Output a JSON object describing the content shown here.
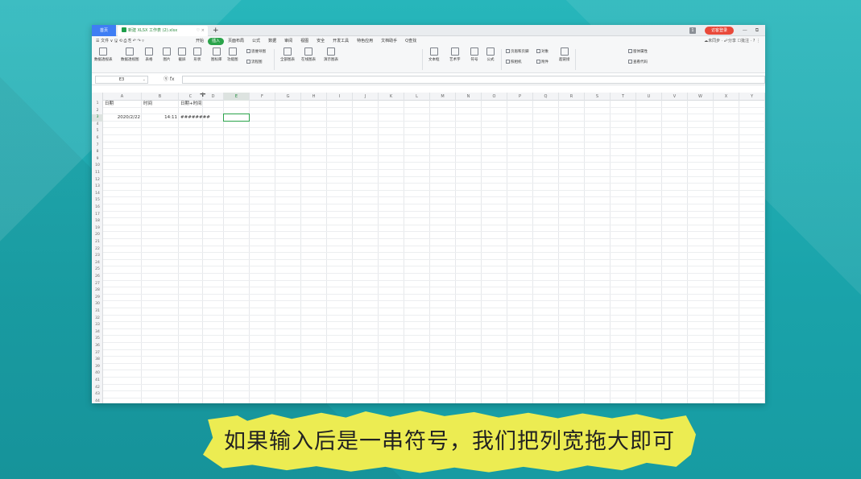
{
  "titlebar": {
    "home_tab": "首页",
    "doc_tab": "新建 XLSX 工作表 (2).xlsx",
    "doc_tab_actions": "♡ ×",
    "add_tab": "+",
    "badge": "1",
    "login_button": "访客登录",
    "window_controls": "— ⧉"
  },
  "menubar": {
    "left_text": "☰ 文件 ∨  🖫 ⟲ ⎙ ⎘ ↶ ↷ ▿",
    "items": [
      "开始",
      "插入",
      "页面布局",
      "公式",
      "数据",
      "审阅",
      "视图",
      "安全",
      "开发工具",
      "特色应用",
      "文档助手",
      "Q查找"
    ],
    "active_item": "插入",
    "right_text": "☁未同步 · ☍分享 ☐批注 · ? ⋮"
  },
  "ribbon": {
    "large_buttons": [
      "数据透视表",
      "数据透视图",
      "表格",
      "图片",
      "截屏",
      "形状",
      "图标库",
      "功能图",
      "全部图表",
      "在线图表",
      "演示图表",
      "文本框",
      "艺术字",
      "符号",
      "公式",
      "超链接"
    ],
    "small_row1": [
      "思维导图",
      "页眉和页脚",
      "对象",
      "窗体属性"
    ],
    "small_row2": [
      "流程图",
      "照相机",
      "附件",
      "查看代码"
    ]
  },
  "formulabar": {
    "name_box": "E3",
    "fx_label": "ⓠ fx",
    "formula": ""
  },
  "grid": {
    "columns": [
      "A",
      "B",
      "C",
      "D",
      "E",
      "F",
      "G",
      "H",
      "I",
      "J",
      "K",
      "L",
      "M",
      "N",
      "O",
      "P",
      "Q",
      "R",
      "S",
      "T",
      "U",
      "V",
      "W",
      "X",
      "Y"
    ],
    "selected_column": "E",
    "selected_row": "3",
    "row_count": 44,
    "cells": {
      "A1": "日期",
      "B1": "时间",
      "C1": "日期+时间",
      "A3": "2020/2/22",
      "B3": "14:11",
      "C3": "########"
    },
    "cursor_symbol": "✛"
  },
  "caption": {
    "text": "如果输入后是一串符号，我们把列宽拖大即可"
  },
  "colors": {
    "accent_green": "#2aa34a",
    "home_tab_blue": "#3f7ef4",
    "login_red": "#e9493a",
    "background_teal": "#1fa9b0",
    "caption_yellow": "#ecec52"
  }
}
